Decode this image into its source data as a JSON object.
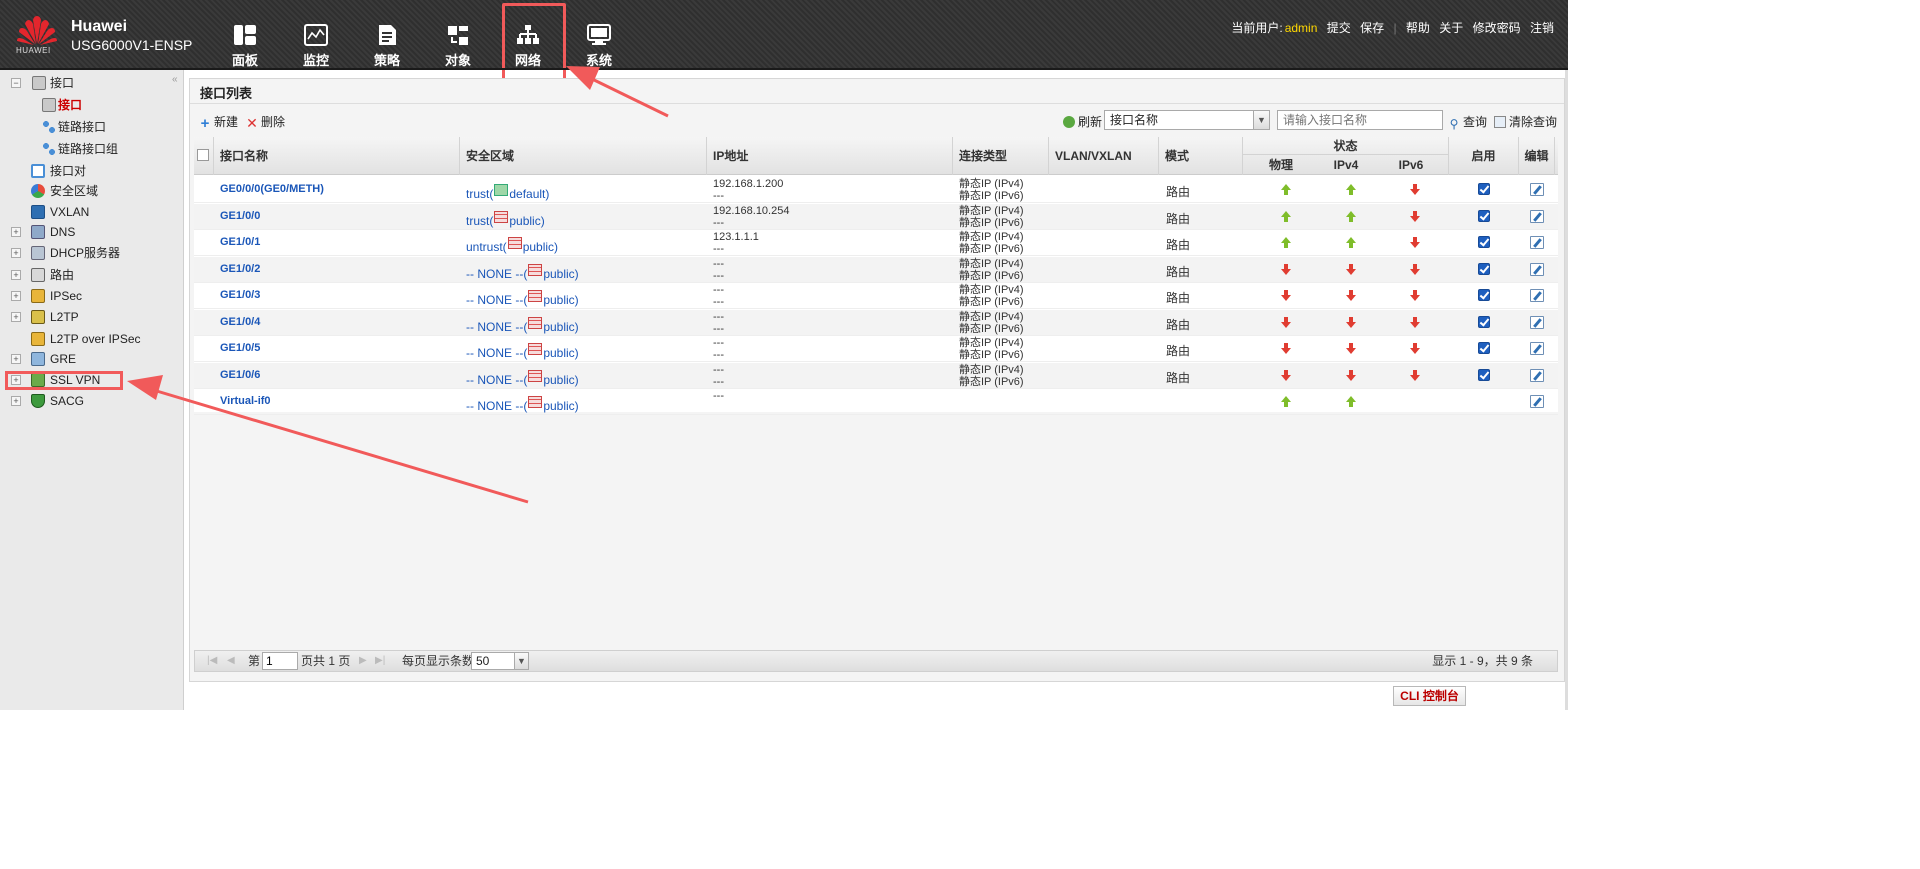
{
  "header": {
    "logo_text": "HUAWEI",
    "brand_line1": "Huawei",
    "brand_line2": "USG6000V1-ENSP",
    "nav": [
      {
        "label": "面板",
        "icon": "dashboard-icon"
      },
      {
        "label": "监控",
        "icon": "monitor-icon"
      },
      {
        "label": "策略",
        "icon": "policy-icon"
      },
      {
        "label": "对象",
        "icon": "object-icon"
      },
      {
        "label": "网络",
        "icon": "network-icon"
      },
      {
        "label": "系统",
        "icon": "system-icon"
      }
    ],
    "current_user_label": "当前用户:",
    "current_user": "admin",
    "links": [
      "提交",
      "保存",
      "帮助",
      "关于",
      "修改密码",
      "注销"
    ]
  },
  "sidebar": {
    "items": [
      {
        "label": "接口",
        "expander": "−",
        "icon": "interface-group-icon"
      },
      {
        "label": "接口",
        "icon": "interface-icon",
        "active": true
      },
      {
        "label": "链路接口",
        "icon": "link-interface-icon"
      },
      {
        "label": "链路接口组",
        "icon": "link-interface-group-icon"
      },
      {
        "label": "接口对",
        "icon": "interface-pair-icon"
      },
      {
        "label": "安全区域",
        "icon": "security-zone-icon"
      },
      {
        "label": "VXLAN",
        "icon": "vxlan-icon"
      },
      {
        "label": "DNS",
        "expander": "+",
        "icon": "dns-icon"
      },
      {
        "label": "DHCP服务器",
        "expander": "+",
        "icon": "dhcp-icon"
      },
      {
        "label": "路由",
        "expander": "+",
        "icon": "route-icon"
      },
      {
        "label": "IPSec",
        "expander": "+",
        "icon": "ipsec-icon"
      },
      {
        "label": "L2TP",
        "expander": "+",
        "icon": "l2tp-icon"
      },
      {
        "label": "L2TP over IPSec",
        "icon": "l2tp-over-ipsec-icon"
      },
      {
        "label": "GRE",
        "expander": "+",
        "icon": "gre-icon"
      },
      {
        "label": "SSL VPN",
        "expander": "+",
        "icon": "ssl-vpn-icon"
      },
      {
        "label": "SACG",
        "expander": "+",
        "icon": "sacg-icon"
      }
    ]
  },
  "panel": {
    "title": "接口列表",
    "toolbar": {
      "new_label": "新建",
      "delete_label": "删除",
      "refresh_label": "刷新",
      "filter_field": "接口名称",
      "search_placeholder": "请输入接口名称",
      "query_label": "查询",
      "clear_label": "清除查询"
    },
    "columns": {
      "name": "接口名称",
      "zone": "安全区域",
      "ip": "IP地址",
      "conn": "连接类型",
      "vlan": "VLAN/VXLAN",
      "mode": "模式",
      "status": "状态",
      "status_physical": "物理",
      "status_ipv4": "IPv4",
      "status_ipv6": "IPv6",
      "enable": "启用",
      "edit": "编辑"
    },
    "rows": [
      {
        "name": "GE0/0/0(GE0/METH)",
        "zone_prefix": "trust(",
        "vsys": "default)",
        "ip1": "192.168.1.200",
        "ip2": "---",
        "conn1": "静态IP (IPv4)",
        "conn2": "静态IP (IPv6)",
        "mode": "路由",
        "phy": "up",
        "ipv4": "up",
        "ipv6": "down",
        "enabled": true
      },
      {
        "name": "GE1/0/0",
        "zone_prefix": "trust(",
        "vsys": "public)",
        "ip1": "192.168.10.254",
        "ip2": "---",
        "conn1": "静态IP (IPv4)",
        "conn2": "静态IP (IPv6)",
        "mode": "路由",
        "phy": "up",
        "ipv4": "up",
        "ipv6": "down",
        "enabled": true
      },
      {
        "name": "GE1/0/1",
        "zone_prefix": "untrust(",
        "vsys": "public)",
        "ip1": "123.1.1.1",
        "ip2": "---",
        "conn1": "静态IP (IPv4)",
        "conn2": "静态IP (IPv6)",
        "mode": "路由",
        "phy": "up",
        "ipv4": "up",
        "ipv6": "down",
        "enabled": true
      },
      {
        "name": "GE1/0/2",
        "zone_prefix": "-- NONE --(",
        "vsys": "public)",
        "ip1": "---",
        "ip2": "---",
        "conn1": "静态IP (IPv4)",
        "conn2": "静态IP (IPv6)",
        "mode": "路由",
        "phy": "down",
        "ipv4": "down",
        "ipv6": "down",
        "enabled": true
      },
      {
        "name": "GE1/0/3",
        "zone_prefix": "-- NONE --(",
        "vsys": "public)",
        "ip1": "---",
        "ip2": "---",
        "conn1": "静态IP (IPv4)",
        "conn2": "静态IP (IPv6)",
        "mode": "路由",
        "phy": "down",
        "ipv4": "down",
        "ipv6": "down",
        "enabled": true
      },
      {
        "name": "GE1/0/4",
        "zone_prefix": "-- NONE --(",
        "vsys": "public)",
        "ip1": "---",
        "ip2": "---",
        "conn1": "静态IP (IPv4)",
        "conn2": "静态IP (IPv6)",
        "mode": "路由",
        "phy": "down",
        "ipv4": "down",
        "ipv6": "down",
        "enabled": true
      },
      {
        "name": "GE1/0/5",
        "zone_prefix": "-- NONE --(",
        "vsys": "public)",
        "ip1": "---",
        "ip2": "---",
        "conn1": "静态IP (IPv4)",
        "conn2": "静态IP (IPv6)",
        "mode": "路由",
        "phy": "down",
        "ipv4": "down",
        "ipv6": "down",
        "enabled": true
      },
      {
        "name": "GE1/0/6",
        "zone_prefix": "-- NONE --(",
        "vsys": "public)",
        "ip1": "---",
        "ip2": "---",
        "conn1": "静态IP (IPv4)",
        "conn2": "静态IP (IPv6)",
        "mode": "路由",
        "phy": "down",
        "ipv4": "down",
        "ipv6": "down",
        "enabled": true
      },
      {
        "name": "Virtual-if0",
        "zone_prefix": "-- NONE --(",
        "vsys": "public)",
        "ip1": "---",
        "ip2": "",
        "conn1": "",
        "conn2": "",
        "mode": "",
        "phy": "up",
        "ipv4": "up",
        "ipv6": "",
        "enabled": null
      }
    ],
    "pager": {
      "page_prefix": "第",
      "page_value": "1",
      "page_suffix": "页共 1 页",
      "per_page_label": "每页显示条数",
      "per_page_value": "50",
      "summary": "显示 1 - 9，共 9 条"
    }
  },
  "cli_button": "CLI 控制台",
  "colors": {
    "accent_red": "#f15a5a",
    "link_blue": "#1a56b8",
    "status_up": "#7fbd2a",
    "status_down": "#e03c31",
    "user_yellow": "#ffd800"
  }
}
